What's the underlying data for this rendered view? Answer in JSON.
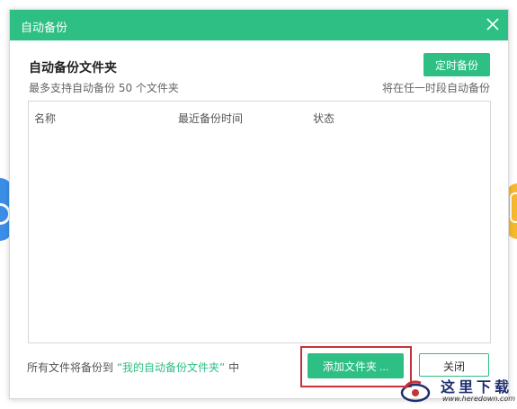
{
  "dialog": {
    "title": "自动备份",
    "close_icon": "close-icon"
  },
  "header": {
    "section_title": "自动备份文件夹",
    "schedule_button": "定时备份",
    "subtitle": "最多支持自动备份 50 个文件夹",
    "schedule_hint": "将在任一时段自动备份"
  },
  "table": {
    "columns": [
      "名称",
      "最近备份时间",
      "状态"
    ],
    "rows": []
  },
  "footer": {
    "note_prefix": "所有文件将备份到",
    "note_link": "“我的自动备份文件夹”",
    "note_suffix": "中",
    "add_button": "添加文件夹 ...",
    "close_button": "关闭"
  },
  "watermark": {
    "text": "这里下载",
    "url": "www.heredown.com"
  },
  "colors": {
    "accent": "#2dbf84",
    "highlight_frame": "#c8323a"
  }
}
